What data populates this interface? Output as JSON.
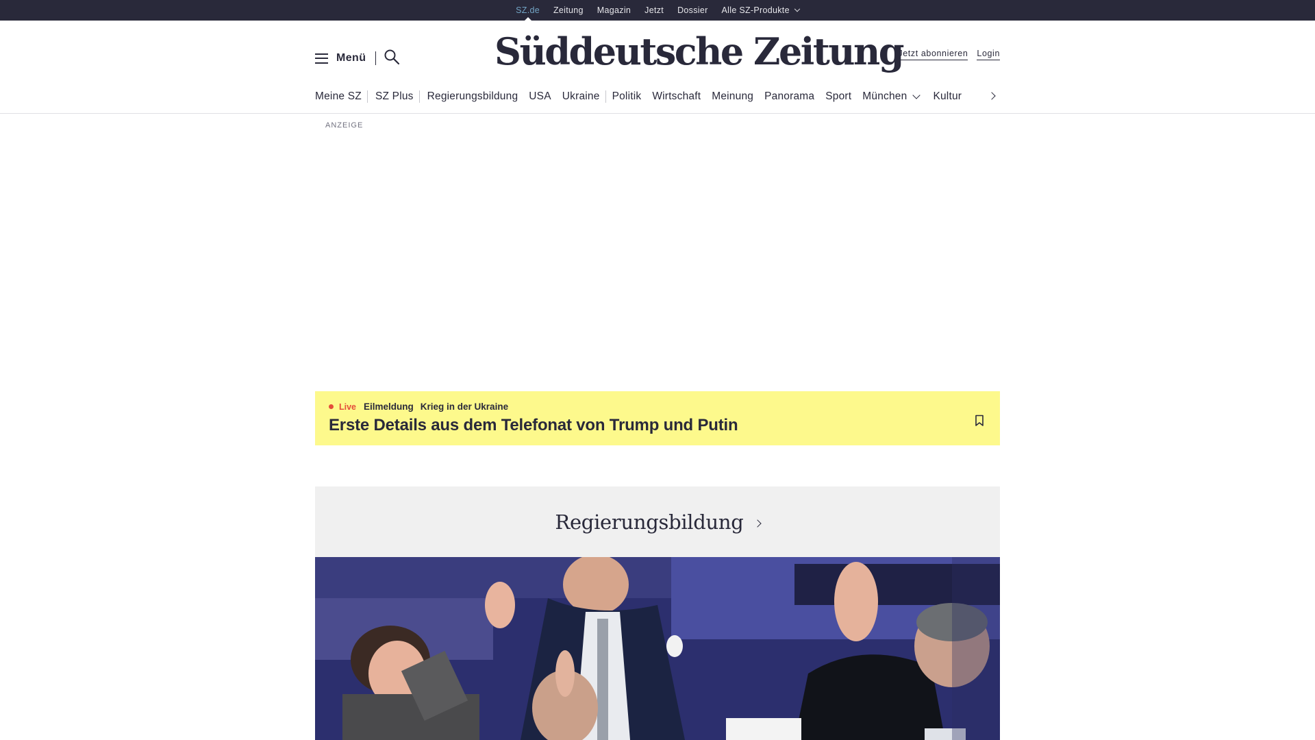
{
  "topbar": {
    "items": [
      {
        "label": "SZ.de"
      },
      {
        "label": "Zeitung"
      },
      {
        "label": "Magazin"
      },
      {
        "label": "Jetzt"
      },
      {
        "label": "Dossier"
      },
      {
        "label": "Alle SZ-Produkte"
      }
    ],
    "active": "SZ.de"
  },
  "header": {
    "menu_label": "Menü",
    "logo_text": "Süddeutsche Zeitung",
    "subscribe_label": "Jetzt abonnieren",
    "login_label": "Login"
  },
  "nav": {
    "items": [
      {
        "label": "Meine SZ"
      },
      {
        "label": "SZ Plus"
      },
      {
        "label": "Regierungsbildung"
      },
      {
        "label": "USA"
      },
      {
        "label": "Ukraine"
      },
      {
        "label": "Politik"
      },
      {
        "label": "Wirtschaft"
      },
      {
        "label": "Meinung"
      },
      {
        "label": "Panorama"
      },
      {
        "label": "Sport"
      },
      {
        "label": "München"
      },
      {
        "label": "Kultur"
      }
    ]
  },
  "ad": {
    "label": "ANZEIGE"
  },
  "breaking": {
    "live_label": "Live",
    "kicker": "Eilmeldung",
    "topic": "Krieg in der Ukraine",
    "headline": "Erste Details aus dem Telefonat von Trump und Putin"
  },
  "section": {
    "title": "Regierungsbildung"
  },
  "colors": {
    "topbar_bg": "#29293a",
    "accent_blue": "#73a5c6",
    "breaking_bg": "#fdf98c",
    "live_red": "#e44d3a",
    "section_bg": "#f0f0f0"
  },
  "icons": {
    "menu": "hamburger-icon",
    "search": "search-icon",
    "bookmark": "bookmark-icon",
    "nav_next": "chevron-right-icon",
    "dropdown": "chevron-down-icon"
  }
}
